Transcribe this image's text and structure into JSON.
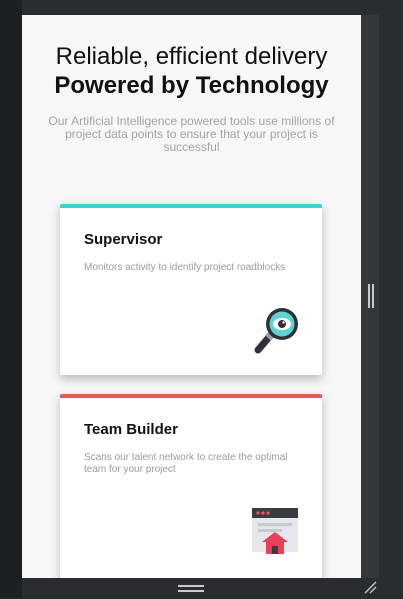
{
  "hero": {
    "line1": "Reliable, efficient delivery",
    "line2": "Powered by Technology",
    "subtext": "Our Artificial Intelligence powered tools use millions of project data points to ensure that your project is successful"
  },
  "cards": [
    {
      "title": "Supervisor",
      "description": "Monitors activity to identify project roadblocks",
      "accent_color": "#3ecfcf",
      "icon": "magnifier-eye-icon"
    },
    {
      "title": "Team Builder",
      "description": "Scans our talent network to create the optimal team for your project",
      "accent_color": "#e85b5b",
      "icon": "team-builder-window-icon"
    }
  ],
  "colors": {
    "page_background": "#f7f7f8",
    "frame": "#2b2c30",
    "headline_text": "#111111",
    "muted_text": "#a1a3a9"
  }
}
